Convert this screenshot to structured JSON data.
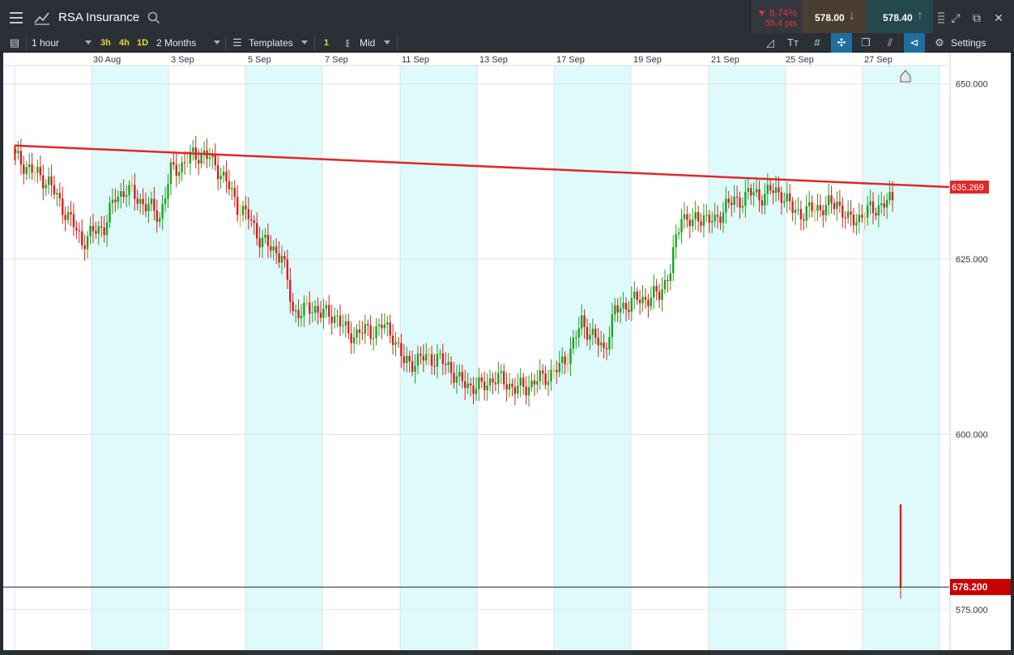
{
  "header": {
    "instrument": "RSA Insurance",
    "change_pct": "▼ 8.74%",
    "change_pts": "55.4 pts",
    "sell_price": "578.00",
    "buy_price": "578.40"
  },
  "toolbar": {
    "interval": "1 hour",
    "quick_intervals": [
      "3h",
      "4h",
      "1D"
    ],
    "range": "2 Months",
    "templates": "Templates",
    "badge": "1",
    "price_type": "Mid",
    "settings": "Settings"
  },
  "colors": {
    "bull": "#1aa31a",
    "bear": "#d81e1e",
    "neutral": "#e6a23c",
    "shade": "#dffafb",
    "trendline": "#e32626",
    "current_price_tag": "#c90000"
  },
  "chart_data": {
    "type": "candlestick",
    "instrument": "RSA Insurance",
    "interval": "1 hour",
    "x_tick_labels": [
      "30 Aug",
      "3 Sep",
      "5 Sep",
      "7 Sep",
      "11 Sep",
      "13 Sep",
      "17 Sep",
      "19 Sep",
      "21 Sep",
      "25 Sep",
      "27 Sep"
    ],
    "y_tick_labels": [
      "650.000",
      "625.000",
      "600.000",
      "575.000"
    ],
    "y_ticks": [
      650,
      625,
      600,
      575
    ],
    "ylim": [
      569.2,
      652.6
    ],
    "trendline": {
      "start_price": 641.2,
      "end_price": 635.269,
      "label": "635.269"
    },
    "current_price": {
      "value": 578.2,
      "label": "578.200"
    },
    "day_closes": [
      [
        639.5,
        638.2,
        637.0,
        636.0,
        633.0
      ],
      [
        630.5,
        627.5,
        628.8,
        629.7,
        633.7
      ],
      [
        635.0,
        633.6,
        632.5,
        631.0,
        637.5
      ],
      [
        638.4,
        639.8,
        640.0,
        638.5,
        636.0
      ],
      [
        632.6,
        631.0,
        628.0,
        626.5,
        625.6
      ],
      [
        617.5,
        617.6,
        618.0,
        617.0,
        616.8
      ],
      [
        614.0,
        614.7,
        614.6,
        615.5,
        614.2
      ],
      [
        610.2,
        610.4,
        611.0,
        610.7,
        609.8
      ],
      [
        607.5,
        606.9,
        606.7,
        608.0,
        607.6
      ],
      [
        606.5,
        606.8,
        607.7,
        608.4,
        609.5
      ],
      [
        612.0,
        616.0,
        614.0,
        612.0,
        617.5
      ],
      [
        618.5,
        619.2,
        619.4,
        620.0,
        623.5
      ],
      [
        631.5,
        630.0,
        631.3,
        630.0,
        633.0
      ],
      [
        633.0,
        634.5,
        633.9,
        634.7,
        634.4
      ],
      [
        632.0,
        631.5,
        632.3,
        632.4,
        633.2
      ],
      [
        630.4,
        631.0,
        632.0,
        632.7,
        633.4
      ]
    ]
  }
}
